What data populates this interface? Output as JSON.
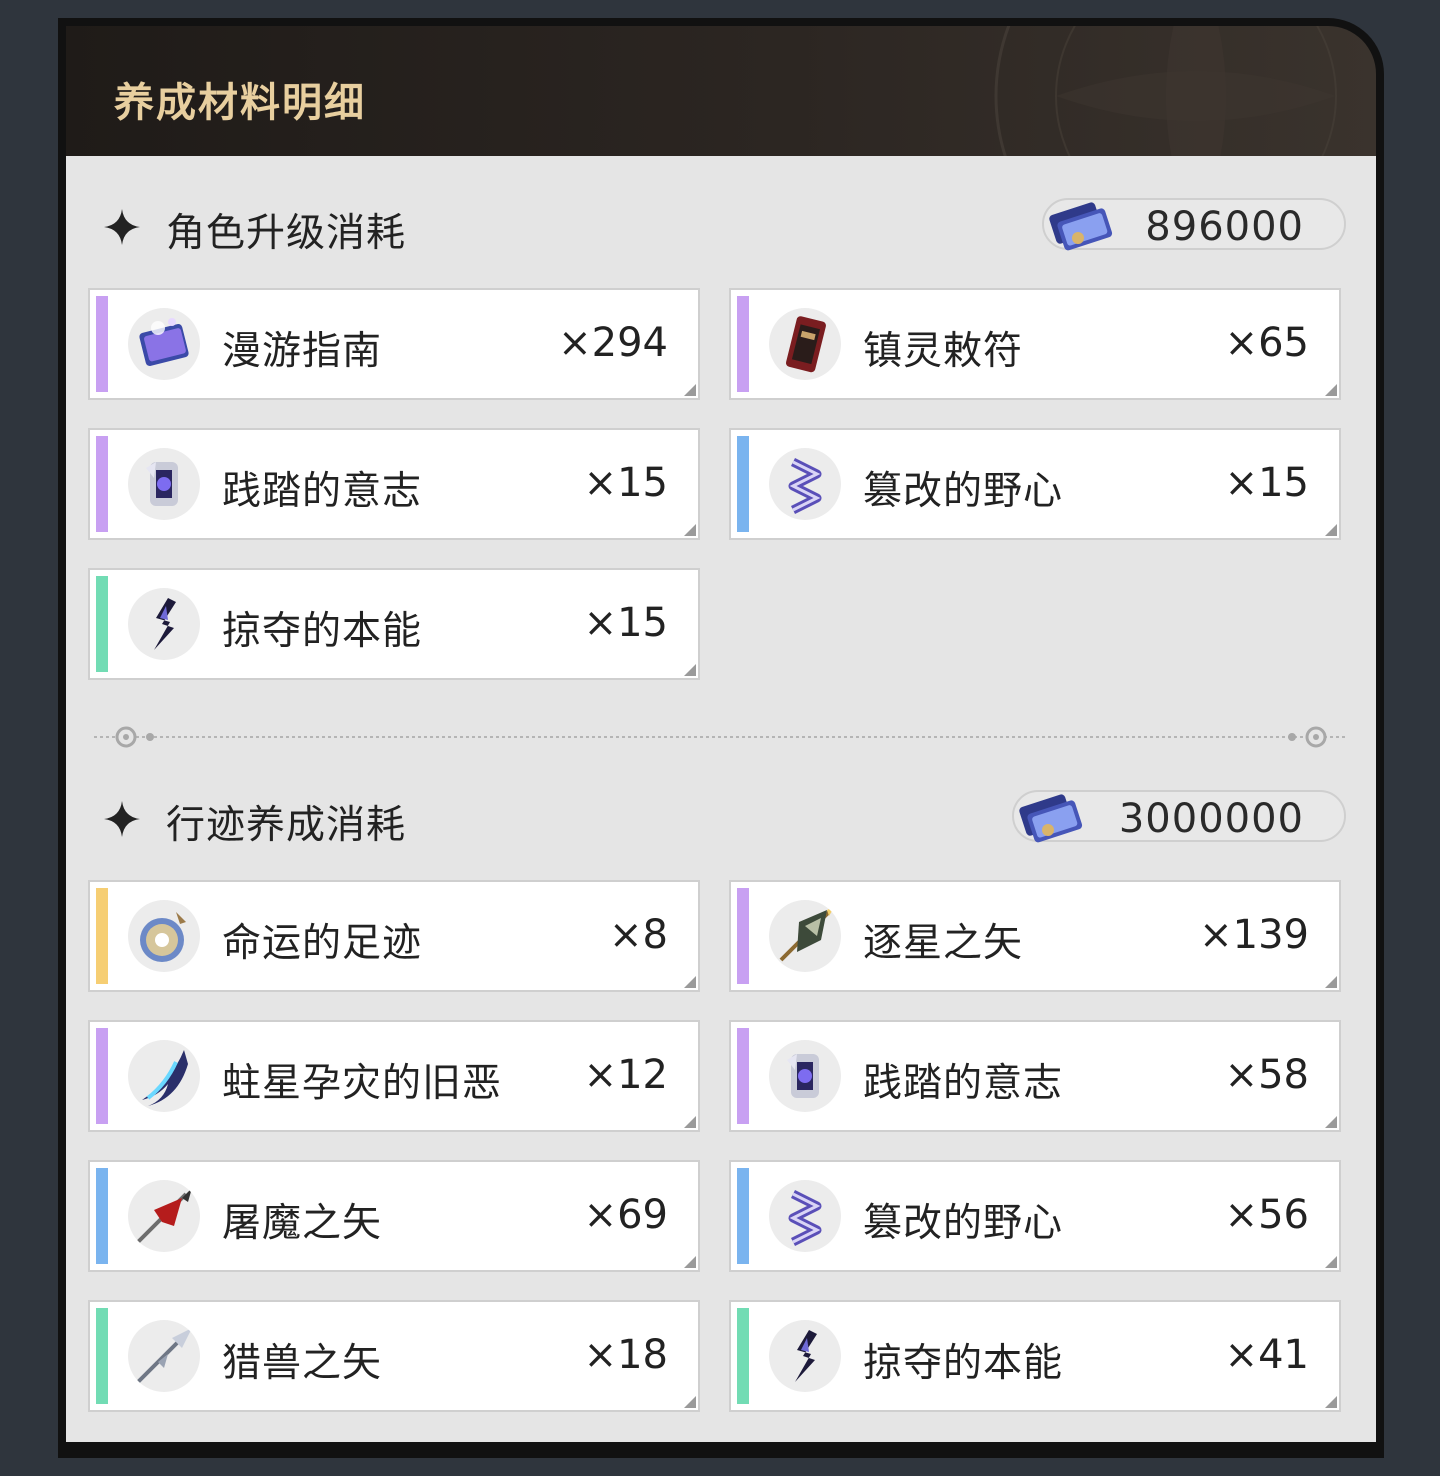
{
  "header": {
    "title": "养成材料明细"
  },
  "colors": {
    "purple": "#c8a0f2",
    "blue": "#7ab4ef",
    "green": "#72dcb4",
    "gold": "#f6ce73",
    "title_gold": "#e8cf9f"
  },
  "sections": [
    {
      "title": "角色升级消耗",
      "credit_icon": "credit-icon",
      "credits": "896000",
      "items": [
        {
          "name": "漫游指南",
          "qty": "×294",
          "rarity": "purple",
          "icon": "book-icon"
        },
        {
          "name": "镇灵敕符",
          "qty": "×65",
          "rarity": "purple",
          "icon": "talisman-icon"
        },
        {
          "name": "践踏的意志",
          "qty": "×15",
          "rarity": "purple",
          "icon": "will-crystal-icon"
        },
        {
          "name": "篡改的野心",
          "qty": "×15",
          "rarity": "blue",
          "icon": "ambition-helix-icon"
        },
        {
          "name": "掠夺的本能",
          "qty": "×15",
          "rarity": "green",
          "icon": "instinct-shard-icon"
        }
      ]
    },
    {
      "title": "行迹养成消耗",
      "credit_icon": "credit-icon",
      "credits": "3000000",
      "items": [
        {
          "name": "命运的足迹",
          "qty": "×8",
          "rarity": "gold",
          "icon": "fate-orb-icon"
        },
        {
          "name": "逐星之矢",
          "qty": "×139",
          "rarity": "purple",
          "icon": "star-arrow-icon"
        },
        {
          "name": "蛀星孕灾的旧恶",
          "qty": "×12",
          "rarity": "purple",
          "icon": "blade-claw-icon"
        },
        {
          "name": "践踏的意志",
          "qty": "×58",
          "rarity": "purple",
          "icon": "will-crystal-icon"
        },
        {
          "name": "屠魔之矢",
          "qty": "×69",
          "rarity": "blue",
          "icon": "red-arrow-icon"
        },
        {
          "name": "篡改的野心",
          "qty": "×56",
          "rarity": "blue",
          "icon": "ambition-helix-icon"
        },
        {
          "name": "猎兽之矢",
          "qty": "×18",
          "rarity": "green",
          "icon": "silver-arrow-icon"
        },
        {
          "name": "掠夺的本能",
          "qty": "×41",
          "rarity": "green",
          "icon": "instinct-shard-icon"
        }
      ]
    }
  ]
}
